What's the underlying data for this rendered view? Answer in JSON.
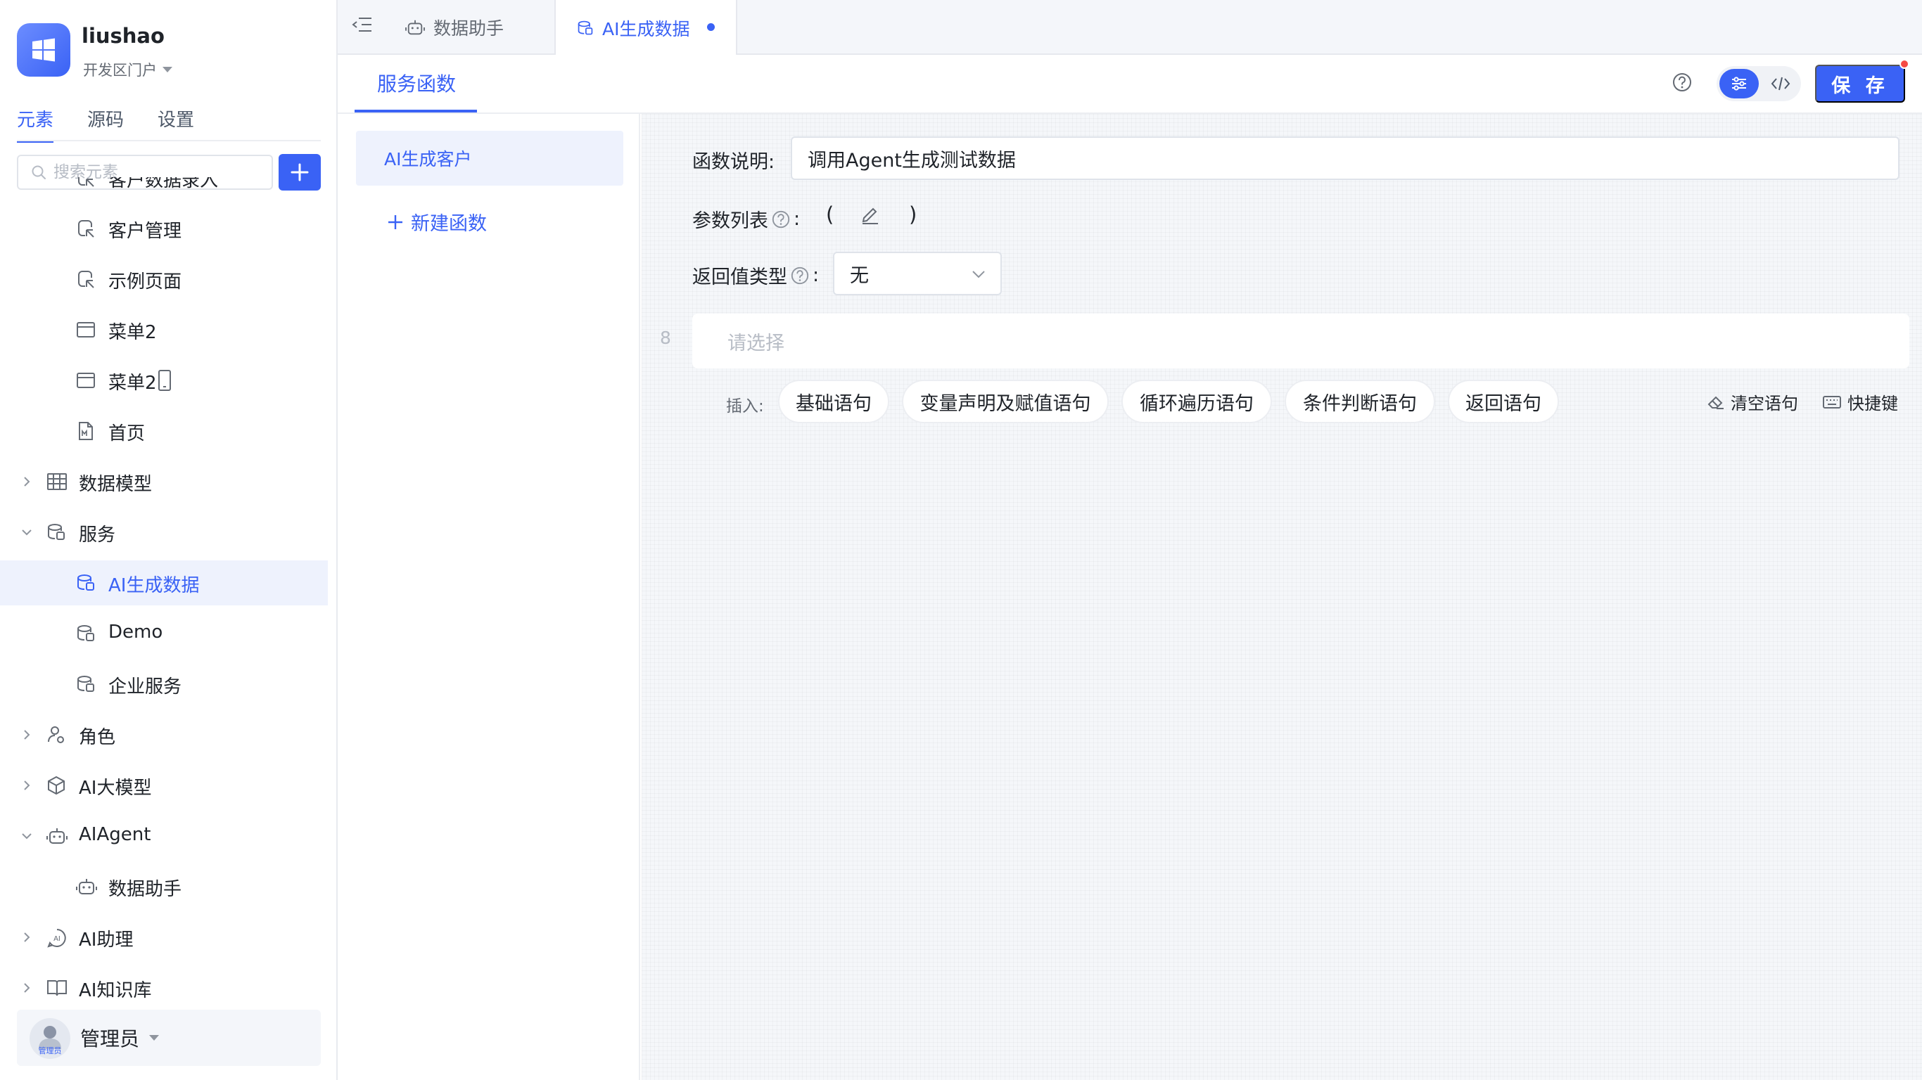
{
  "app": {
    "name": "liushao",
    "workspace": "开发区门户"
  },
  "sidebar": {
    "tabs": [
      {
        "label": "元素",
        "active": true
      },
      {
        "label": "源码",
        "active": false
      },
      {
        "label": "设置",
        "active": false
      }
    ],
    "search_placeholder": "搜索元素",
    "tree": [
      {
        "label": "客户数据录入",
        "icon": "page-link-icon",
        "level": 1
      },
      {
        "label": "客户管理",
        "icon": "page-link-icon",
        "level": 1
      },
      {
        "label": "示例页面",
        "icon": "page-link-icon",
        "level": 1
      },
      {
        "label": "菜单2",
        "icon": "window-icon",
        "level": 1
      },
      {
        "label": "菜单2",
        "icon": "window-icon",
        "level": 1,
        "suffix_icon": "mobile-icon"
      },
      {
        "label": "首页",
        "icon": "markdown-file-icon",
        "level": 1
      },
      {
        "label": "数据模型",
        "icon": "table-icon",
        "level": 0,
        "expanded": false
      },
      {
        "label": "服务",
        "icon": "database-icon",
        "level": 0,
        "expanded": true
      },
      {
        "label": "AI生成数据",
        "icon": "database-icon",
        "level": 1,
        "selected": true
      },
      {
        "label": "Demo",
        "icon": "database-icon",
        "level": 1
      },
      {
        "label": "企业服务",
        "icon": "database-icon",
        "level": 1
      },
      {
        "label": "角色",
        "icon": "role-icon",
        "level": 0,
        "expanded": false
      },
      {
        "label": "AI大模型",
        "icon": "cube-icon",
        "level": 0,
        "expanded": false
      },
      {
        "label": "AIAgent",
        "icon": "robot-icon",
        "level": 0,
        "expanded": true
      },
      {
        "label": "数据助手",
        "icon": "robot-icon",
        "level": 1
      },
      {
        "label": "AI助理",
        "icon": "ai-assistant-icon",
        "level": 0,
        "expanded": false
      },
      {
        "label": "AI知识库",
        "icon": "book-icon",
        "level": 0,
        "expanded": false
      }
    ],
    "user": {
      "name": "管理员",
      "avatar_text": "管理员"
    }
  },
  "doc_tabs": [
    {
      "label": "数据助手",
      "icon": "robot-icon",
      "active": false
    },
    {
      "label": "AI生成数据",
      "icon": "database-icon",
      "active": true,
      "unsaved": true
    }
  ],
  "header": {
    "tab_label": "服务函数",
    "save_label": "保 存"
  },
  "functions": {
    "items": [
      {
        "label": "AI生成客户",
        "selected": true
      }
    ],
    "new_label": "新建函数"
  },
  "editor": {
    "desc_label": "函数说明:",
    "desc_value": "调用Agent生成测试数据",
    "params_label": "参数列表",
    "params_suffix": ":",
    "paren_open": "(",
    "paren_close": ")",
    "return_label": "返回值类型",
    "return_suffix": ":",
    "return_value": "无",
    "line_number": "8",
    "statement_placeholder": "请选择",
    "insert_label": "插入:",
    "chips": [
      "基础语句",
      "变量声明及赋值语句",
      "循环遍历语句",
      "条件判断语句",
      "返回语句"
    ],
    "clear_label": "清空语句",
    "shortcut_label": "快捷键"
  },
  "colors": {
    "accent": "#3a62f5",
    "selected_bg": "#eef2fd",
    "badge": "#f54a45"
  }
}
